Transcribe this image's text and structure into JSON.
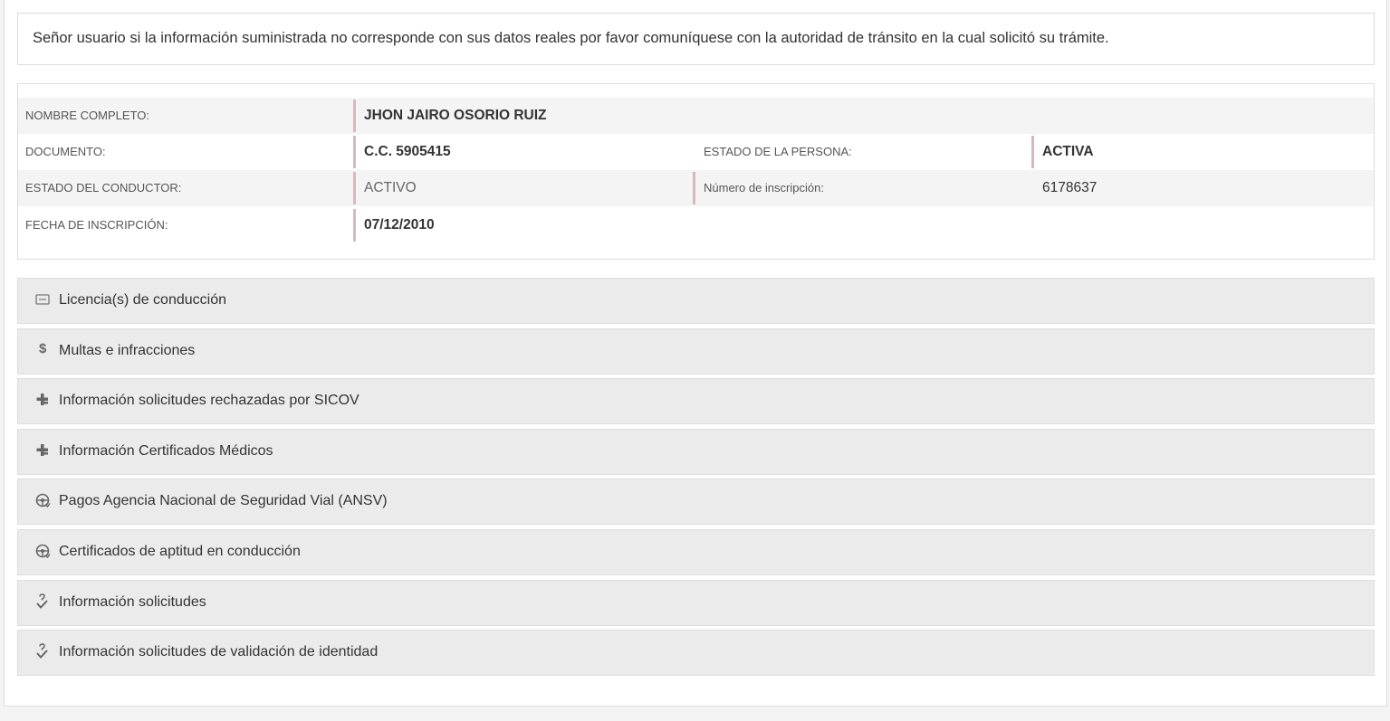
{
  "notice": {
    "text": "Señor usuario si la información suministrada no corresponde con sus datos reales por favor comuníquese con la autoridad de tránsito en la cual solicitó su trámite."
  },
  "person": {
    "nombre_label": "NOMBRE COMPLETO:",
    "nombre_value": "JHON JAIRO OSORIO RUIZ",
    "documento_label": "DOCUMENTO:",
    "documento_value": "C.C. 5905415",
    "estado_persona_label": "ESTADO DE LA PERSONA:",
    "estado_persona_value": "ACTIVA",
    "estado_conductor_label": "ESTADO DEL CONDUCTOR:",
    "estado_conductor_value": "ACTIVO",
    "numero_inscripcion_label": "Número de inscripción:",
    "numero_inscripcion_value": "6178637",
    "fecha_inscripcion_label": "FECHA DE INSCRIPCIÓN:",
    "fecha_inscripcion_value": "07/12/2010"
  },
  "accordion": [
    {
      "label": "Licencia(s) de conducción",
      "icon": "id-card-icon"
    },
    {
      "label": "Multas e infracciones",
      "icon": "dollar-icon"
    },
    {
      "label": "Información solicitudes rechazadas por SICOV",
      "icon": "medical-cross-icon"
    },
    {
      "label": "Información Certificados Médicos",
      "icon": "medical-cross-icon"
    },
    {
      "label": "Pagos Agencia Nacional de Seguridad Vial (ANSV)",
      "icon": "steering-wheel-icon"
    },
    {
      "label": "Certificados de aptitud en conducción",
      "icon": "steering-wheel-icon"
    },
    {
      "label": "Información solicitudes",
      "icon": "question-check-icon"
    },
    {
      "label": "Información solicitudes de validación de identidad",
      "icon": "question-check-icon"
    }
  ],
  "colors": {
    "divider": "#d7b9bd",
    "accordion_bg": "#ebebeb",
    "row_shade": "#f4f4f4"
  }
}
